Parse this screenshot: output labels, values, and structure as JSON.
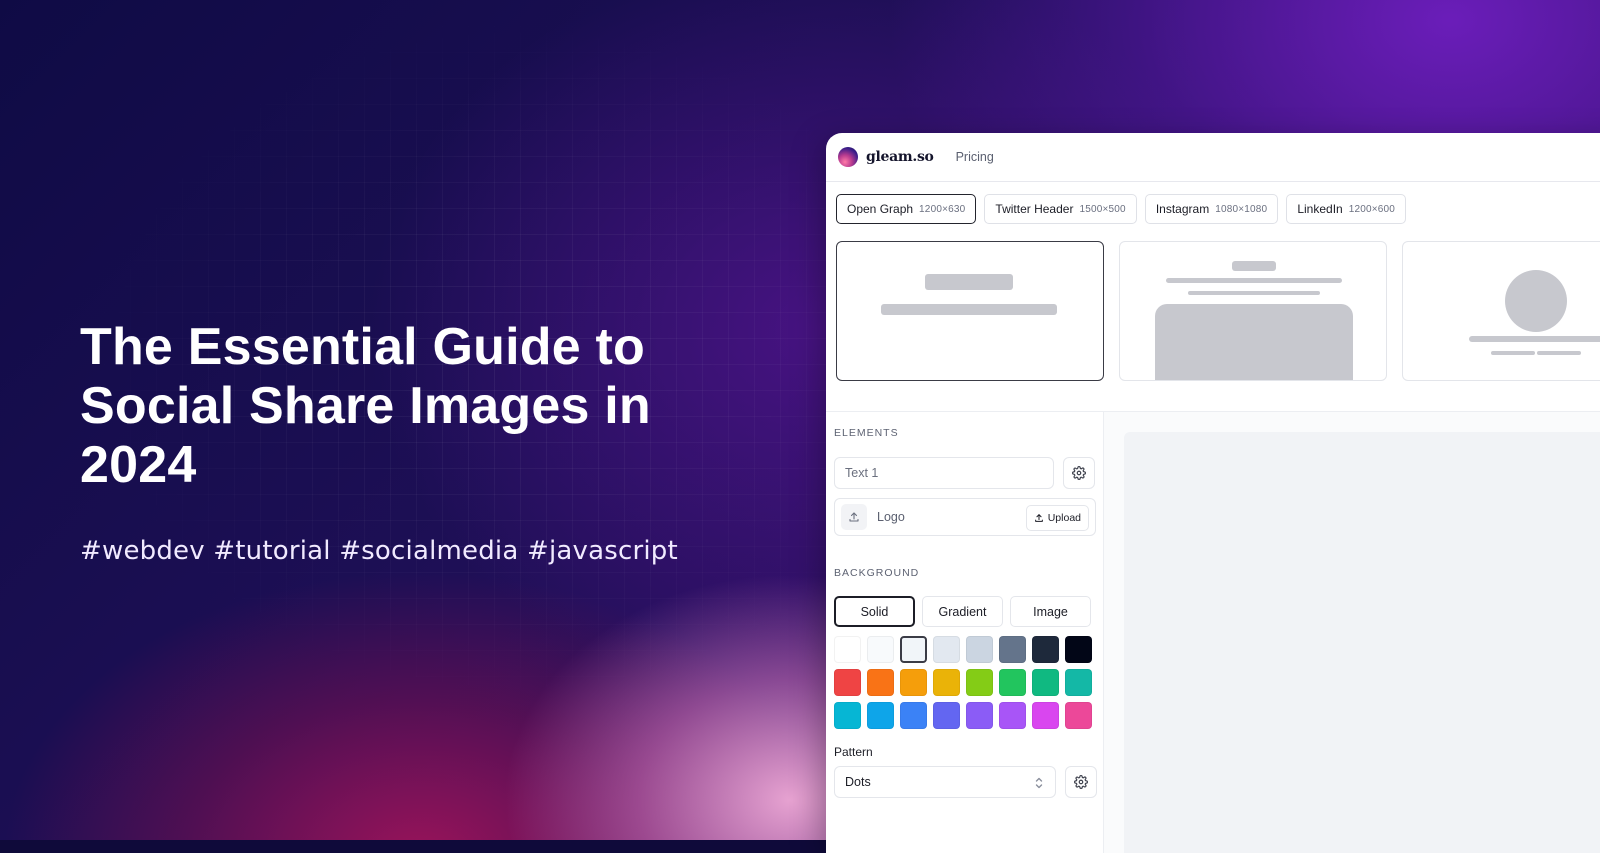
{
  "hero": {
    "title": "The Essential Guide to Social Share Images in 2024",
    "tags": "#webdev #tutorial #socialmedia #javascript"
  },
  "app": {
    "brand": "gleam.so",
    "nav": {
      "pricing": "Pricing"
    },
    "sizes": [
      {
        "label": "Open Graph",
        "dim": "1200×630",
        "active": true
      },
      {
        "label": "Twitter Header",
        "dim": "1500×500",
        "active": false
      },
      {
        "label": "Instagram",
        "dim": "1080×1080",
        "active": false
      },
      {
        "label": "LinkedIn",
        "dim": "1200×600",
        "active": false
      }
    ],
    "elements": {
      "section_label": "ELEMENTS",
      "text_value": "Text 1",
      "logo_label": "Logo",
      "upload_label": "Upload"
    },
    "background": {
      "section_label": "BACKGROUND",
      "tabs": [
        "Solid",
        "Gradient",
        "Image"
      ],
      "active_tab": "Solid",
      "swatches": [
        "#ffffff",
        "#f8fafc",
        "#f1f5f9",
        "#e2e8f0",
        "#cbd5e1",
        "#64748b",
        "#1e293b",
        "#020617",
        "#ef4444",
        "#f97316",
        "#f59e0b",
        "#eab308",
        "#84cc16",
        "#22c55e",
        "#10b981",
        "#14b8a6",
        "#06b6d4",
        "#0ea5e9",
        "#3b82f6",
        "#6366f1",
        "#8b5cf6",
        "#a855f7",
        "#d946ef",
        "#ec4899"
      ],
      "selected_swatch": "#f1f5f9",
      "pattern_label": "Pattern",
      "pattern_value": "Dots"
    }
  }
}
